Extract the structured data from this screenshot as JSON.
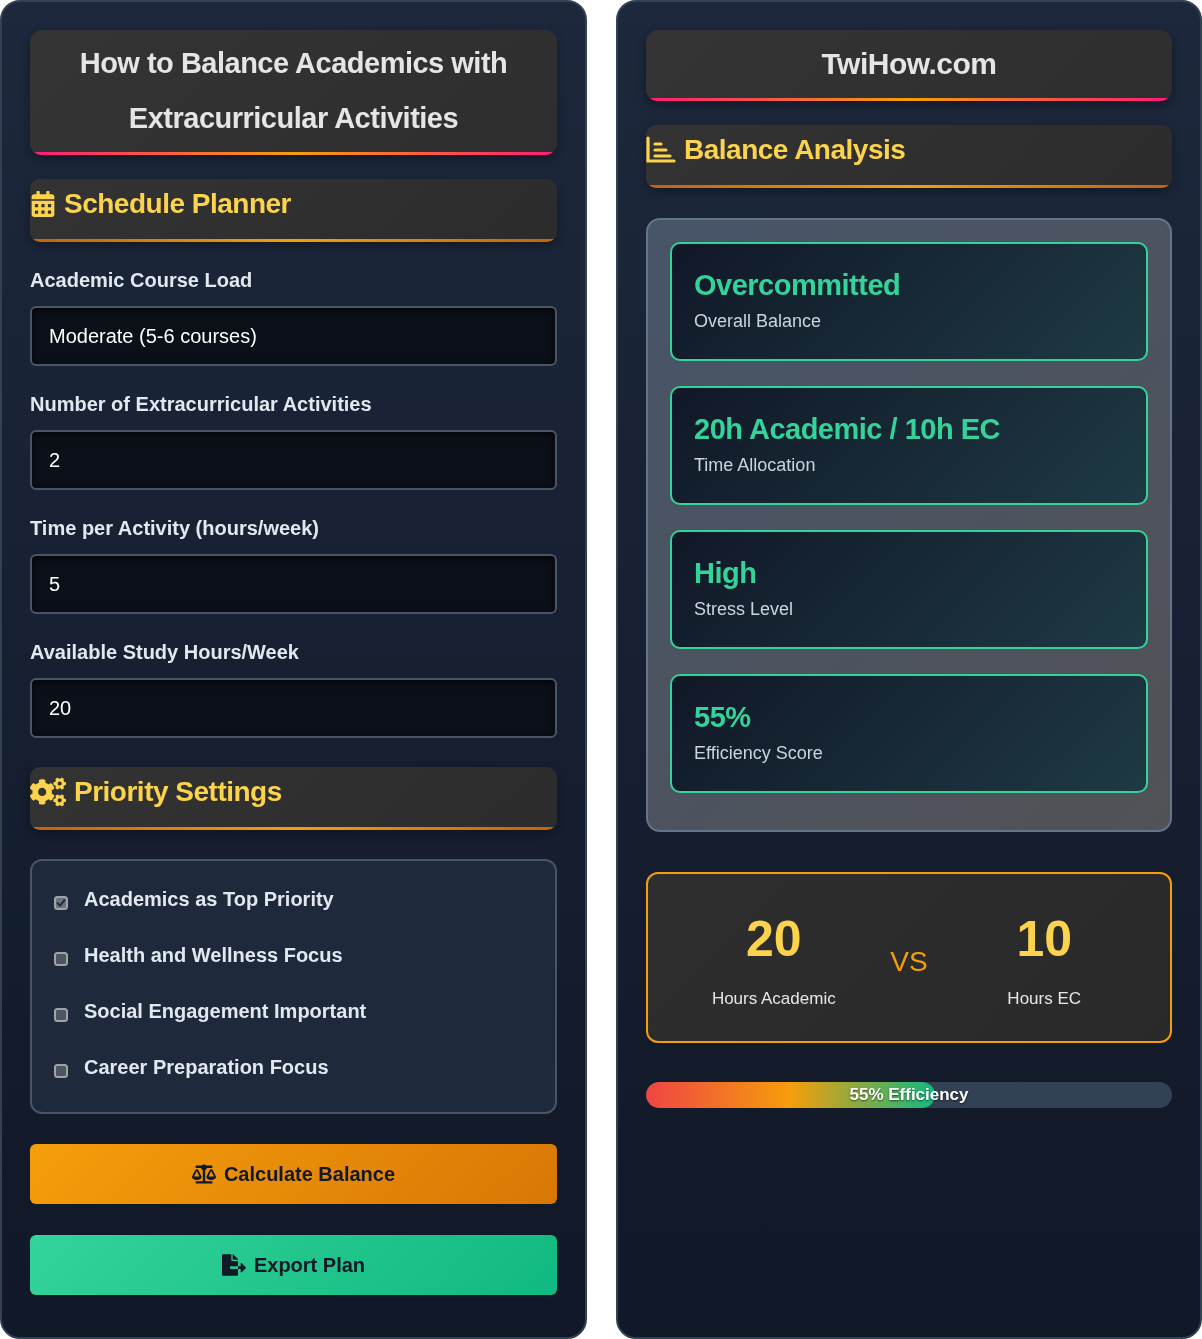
{
  "planner": {
    "title": "How to Balance Academics with Extracurricular Activities",
    "schedule_section": {
      "heading": "Schedule Planner"
    },
    "fields": [
      {
        "label": "Academic Course Load",
        "value": "Moderate (5-6 courses)"
      },
      {
        "label": "Number of Extracurricular Activities",
        "value": "2"
      },
      {
        "label": "Time per Activity (hours/week)",
        "value": "5"
      },
      {
        "label": "Available Study Hours/Week",
        "value": "20"
      }
    ],
    "priority_section": {
      "heading": "Priority Settings"
    },
    "priorities": [
      {
        "label": "Academics as Top Priority",
        "checked": true
      },
      {
        "label": "Health and Wellness Focus",
        "checked": false
      },
      {
        "label": "Social Engagement Important",
        "checked": false
      },
      {
        "label": "Career Preparation Focus",
        "checked": false
      }
    ],
    "buttons": [
      {
        "label": "Calculate Balance",
        "kind": "calculate"
      },
      {
        "label": "Export Plan",
        "kind": "export"
      }
    ]
  },
  "analysis": {
    "site_title": "TwiHow.com",
    "heading": "Balance Analysis",
    "results": [
      {
        "value": "Overcommitted",
        "label": "Overall Balance"
      },
      {
        "value": "20h Academic / 10h EC",
        "label": "Time Allocation"
      },
      {
        "value": "High",
        "label": "Stress Level"
      },
      {
        "value": "55%",
        "label": "Efficiency Score"
      }
    ],
    "comparison": {
      "left": {
        "value": "20",
        "label": "Hours Academic"
      },
      "separator": "VS",
      "right": {
        "value": "10",
        "label": "Hours EC"
      }
    },
    "efficiency": {
      "level": 0.55,
      "label": "55% Efficiency"
    }
  }
}
